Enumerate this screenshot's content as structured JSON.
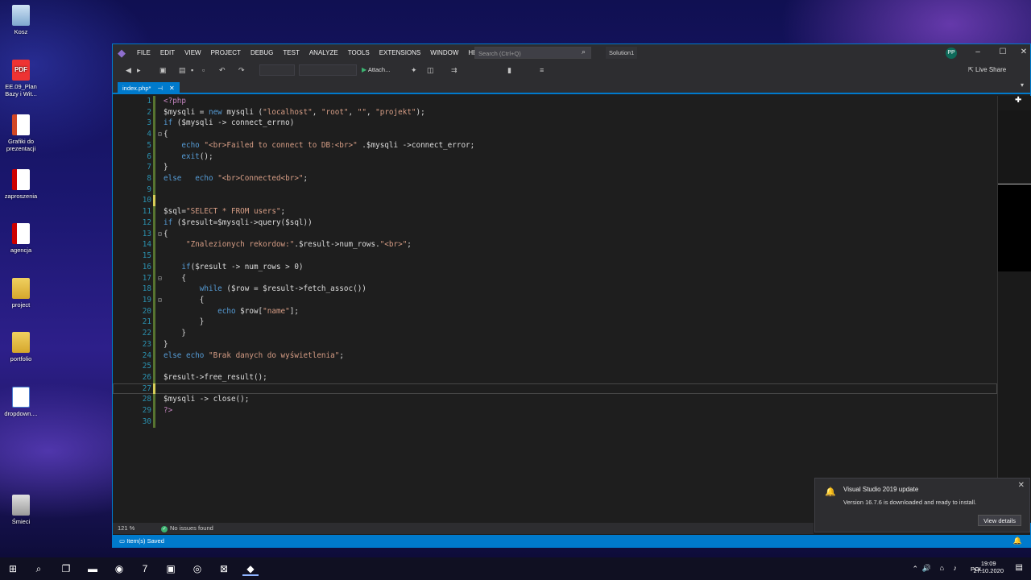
{
  "desktop": {
    "icons": [
      {
        "label": "Kosz",
        "icon": "recycle-bin-icon"
      },
      {
        "label": "EE.09_Plan Bazy i Wit...",
        "icon": "pdf-icon"
      },
      {
        "label": "Grafiki do prezentacji",
        "icon": "presentation-icon"
      },
      {
        "label": "zaproszenia",
        "icon": "document-icon"
      },
      {
        "label": "agencja",
        "icon": "document-icon"
      },
      {
        "label": "project",
        "icon": "folder-icon"
      },
      {
        "label": "portfolio",
        "icon": "folder-icon"
      },
      {
        "label": "dropdown....",
        "icon": "html-file-icon"
      },
      {
        "label": "Śmieci",
        "icon": "trash-icon"
      }
    ]
  },
  "vs": {
    "menu": [
      "FILE",
      "EDIT",
      "VIEW",
      "PROJECT",
      "DEBUG",
      "TEST",
      "ANALYZE",
      "TOOLS",
      "EXTENSIONS",
      "WINDOW",
      "HELP"
    ],
    "search_placeholder": "Search (Ctrl+Q)",
    "solution": "Solution1",
    "avatar": "PP",
    "attach_label": "Attach...",
    "live_share": "Live Share",
    "tab_label": "index.php*",
    "zoom": "121 %",
    "issues": "No issues found",
    "status": "Item(s) Saved",
    "accent": "#007acc"
  },
  "code": [
    {
      "n": "1",
      "text": "<?php"
    },
    {
      "n": "2",
      "text": "$mysqli = new mysqli (\"localhost\", \"root\", \"\", \"projekt\");"
    },
    {
      "n": "3",
      "text": "if ($mysqli -> connect_errno)"
    },
    {
      "n": "4",
      "text": "{"
    },
    {
      "n": "5",
      "text": "    echo \"<br>Failed to connect to DB:<br>\" .$mysqli ->connect_error;"
    },
    {
      "n": "6",
      "text": "    exit();"
    },
    {
      "n": "7",
      "text": "}"
    },
    {
      "n": "8",
      "text": "else   echo \"<br>Connected<br>\";"
    },
    {
      "n": "9",
      "text": ""
    },
    {
      "n": "10",
      "text": ""
    },
    {
      "n": "11",
      "text": "$sql=\"SELECT * FROM users\";"
    },
    {
      "n": "12",
      "text": "if ($result=$mysqli->query($sql))"
    },
    {
      "n": "13",
      "text": "{"
    },
    {
      "n": "14",
      "text": "     \"Znalezionych rekordow:\".$result->num_rows.\"<br>\";"
    },
    {
      "n": "15",
      "text": ""
    },
    {
      "n": "16",
      "text": "    if($result -> num_rows > 0)"
    },
    {
      "n": "17",
      "text": "    {"
    },
    {
      "n": "18",
      "text": "        while ($row = $result->fetch_assoc())"
    },
    {
      "n": "19",
      "text": "        {"
    },
    {
      "n": "20",
      "text": "            echo $row[\"name\"];"
    },
    {
      "n": "21",
      "text": "        }"
    },
    {
      "n": "22",
      "text": "    }"
    },
    {
      "n": "23",
      "text": "}"
    },
    {
      "n": "24",
      "text": "else echo \"Brak danych do wyświetlenia\";"
    },
    {
      "n": "25",
      "text": ""
    },
    {
      "n": "26",
      "text": "$result->free_result();"
    },
    {
      "n": "27",
      "text": ""
    },
    {
      "n": "28",
      "text": "$mysqli -> close();"
    },
    {
      "n": "29",
      "text": "?>"
    },
    {
      "n": "30",
      "text": ""
    }
  ],
  "toast": {
    "title": "Visual Studio 2019 update",
    "message": "Version 16.7.6 is downloaded and ready to install.",
    "button": "View details"
  },
  "taskbar": {
    "language": "POL",
    "time": "19:09",
    "date": "27.10.2020"
  }
}
